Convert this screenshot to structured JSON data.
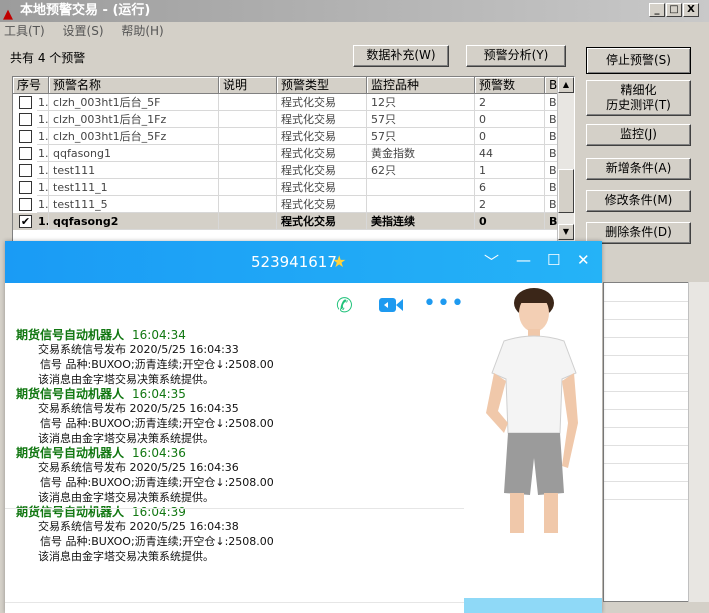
{
  "window": {
    "title": "本地预警交易 - (运行)",
    "controls": [
      "_",
      "□",
      "X"
    ]
  },
  "menu": [
    "工具(T)",
    "设置(S)",
    "帮助(H)"
  ],
  "summary": {
    "count_label": "共有 4 个预警"
  },
  "toolbar": {
    "data_fill": "数据补充(W)",
    "alert_analysis": "预警分析(Y)"
  },
  "side_buttons": {
    "stop": "停止预警(S)",
    "refine_line1": "精细化",
    "refine_line2": "历史测评(T)",
    "monitor": "监控(J)",
    "add": "新增条件(A)",
    "edit": "修改条件(M)",
    "delete": "删除条件(D)"
  },
  "table": {
    "headers": [
      "序号",
      "预警名称",
      "说明",
      "预警类型",
      "监控品种",
      "预警数",
      "B"
    ],
    "rows": [
      {
        "checked": false,
        "idx": "1.",
        "name": "clzh_003ht1后台_5F",
        "desc": "",
        "type": "程式化交易",
        "symbol": "12只",
        "count": "2",
        "b": "B."
      },
      {
        "checked": false,
        "idx": "1.",
        "name": "clzh_003ht1后台_1Fz",
        "desc": "",
        "type": "程式化交易",
        "symbol": "57只",
        "count": "0",
        "b": "B."
      },
      {
        "checked": false,
        "idx": "1.",
        "name": "clzh_003ht1后台_5Fz",
        "desc": "",
        "type": "程式化交易",
        "symbol": "57只",
        "count": "0",
        "b": "B."
      },
      {
        "checked": false,
        "idx": "1.",
        "name": "qqfasong1",
        "desc": "",
        "type": "程式化交易",
        "symbol": "黄金指数",
        "count": "44",
        "b": "B."
      },
      {
        "checked": false,
        "idx": "1.",
        "name": "test111",
        "desc": "",
        "type": "程式化交易",
        "symbol": "62只",
        "count": "1",
        "b": "B."
      },
      {
        "checked": false,
        "idx": "1.",
        "name": "test111_1",
        "desc": "",
        "type": "程式化交易",
        "symbol": "",
        "count": "6",
        "b": "B."
      },
      {
        "checked": false,
        "idx": "1.",
        "name": "test111_5",
        "desc": "",
        "type": "程式化交易",
        "symbol": "",
        "count": "2",
        "b": "B."
      },
      {
        "checked": true,
        "idx": "1.",
        "name": "qqfasong2",
        "desc": "",
        "type": "程式化交易",
        "symbol": "美指连续",
        "count": "0",
        "b": "B."
      }
    ]
  },
  "chat": {
    "contact": "523941617",
    "messages": [
      {
        "sender": "期货信号自动机器人",
        "time": "16:04:34",
        "line1": "交易系统信号发布    2020/5/25 16:04:33",
        "line2": "信号 品种:BUXOO;沥青连续;开空仓↓:2508.00",
        "line3": "该消息由金字塔交易决策系统提供。"
      },
      {
        "sender": "期货信号自动机器人",
        "time": "16:04:35",
        "line1": "交易系统信号发布    2020/5/25 16:04:35",
        "line2": "信号 品种:BUXOO;沥青连续;开空仓↓:2508.00",
        "line3": "该消息由金字塔交易决策系统提供。"
      },
      {
        "sender": "期货信号自动机器人",
        "time": "16:04:36",
        "line1": "交易系统信号发布    2020/5/25 16:04:36",
        "line2": "信号 品种:BUXOO;沥青连续;开空仓↓:2508.00",
        "line3": "该消息由金字塔交易决策系统提供。"
      },
      {
        "sender": "期货信号自动机器人",
        "time": "16:04:39",
        "line1": "交易系统信号发布    2020/5/25 16:04:38",
        "line2": "信号 品种:BUXOO;沥青连续;开空仓↓:2508.00",
        "line3": "该消息由金字塔交易决策系统提供。"
      }
    ]
  }
}
